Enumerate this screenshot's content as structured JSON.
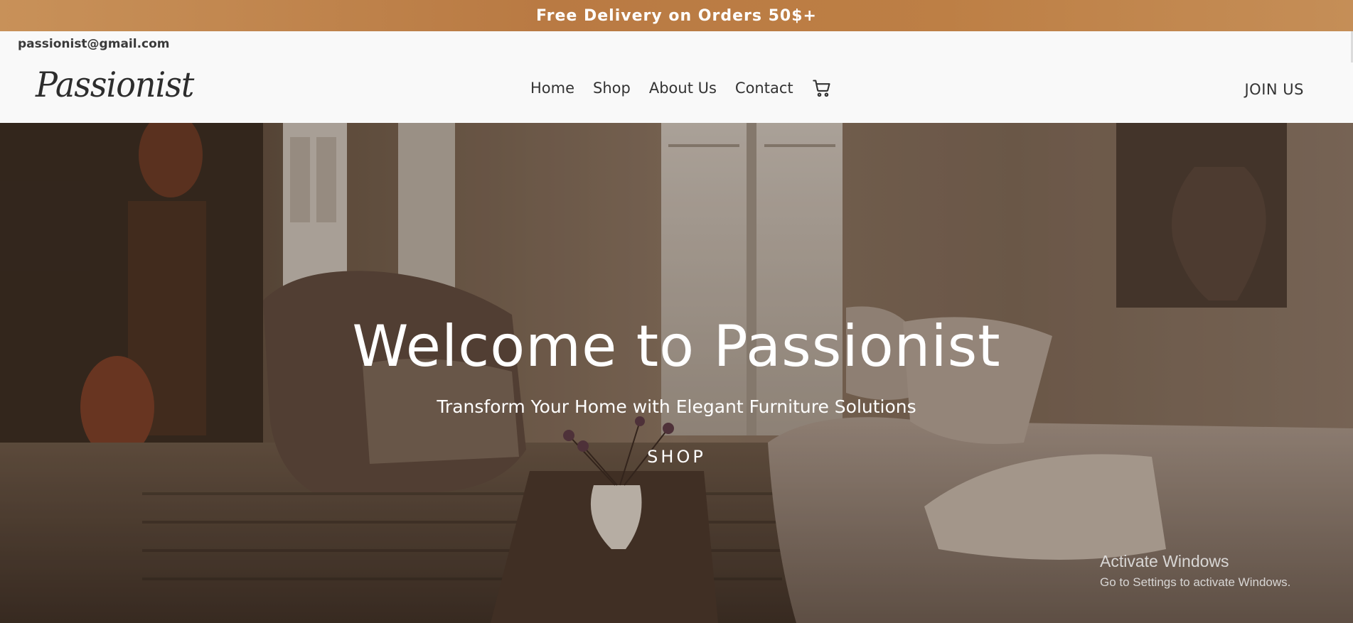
{
  "promo": {
    "text": "Free Delivery on Orders 50$+"
  },
  "header": {
    "email": "passionist@gmail.com",
    "brand": "Passionist",
    "nav": [
      {
        "label": "Home"
      },
      {
        "label": "Shop"
      },
      {
        "label": "About Us"
      },
      {
        "label": "Contact"
      }
    ],
    "cart_icon": "cart-icon",
    "join_label": "JOIN US"
  },
  "hero": {
    "title": "Welcome to Passionist",
    "subtitle": "Transform Your Home with Elegant Furniture Solutions",
    "cta_label": "SHOP"
  },
  "os_watermark": {
    "title": "Activate Windows",
    "subtitle": "Go to Settings to activate Windows."
  },
  "colors": {
    "promo_bar": "#bb7c44",
    "header_bg": "#f9f9f9",
    "text_dark": "#333333",
    "hero_text": "#ffffff"
  }
}
